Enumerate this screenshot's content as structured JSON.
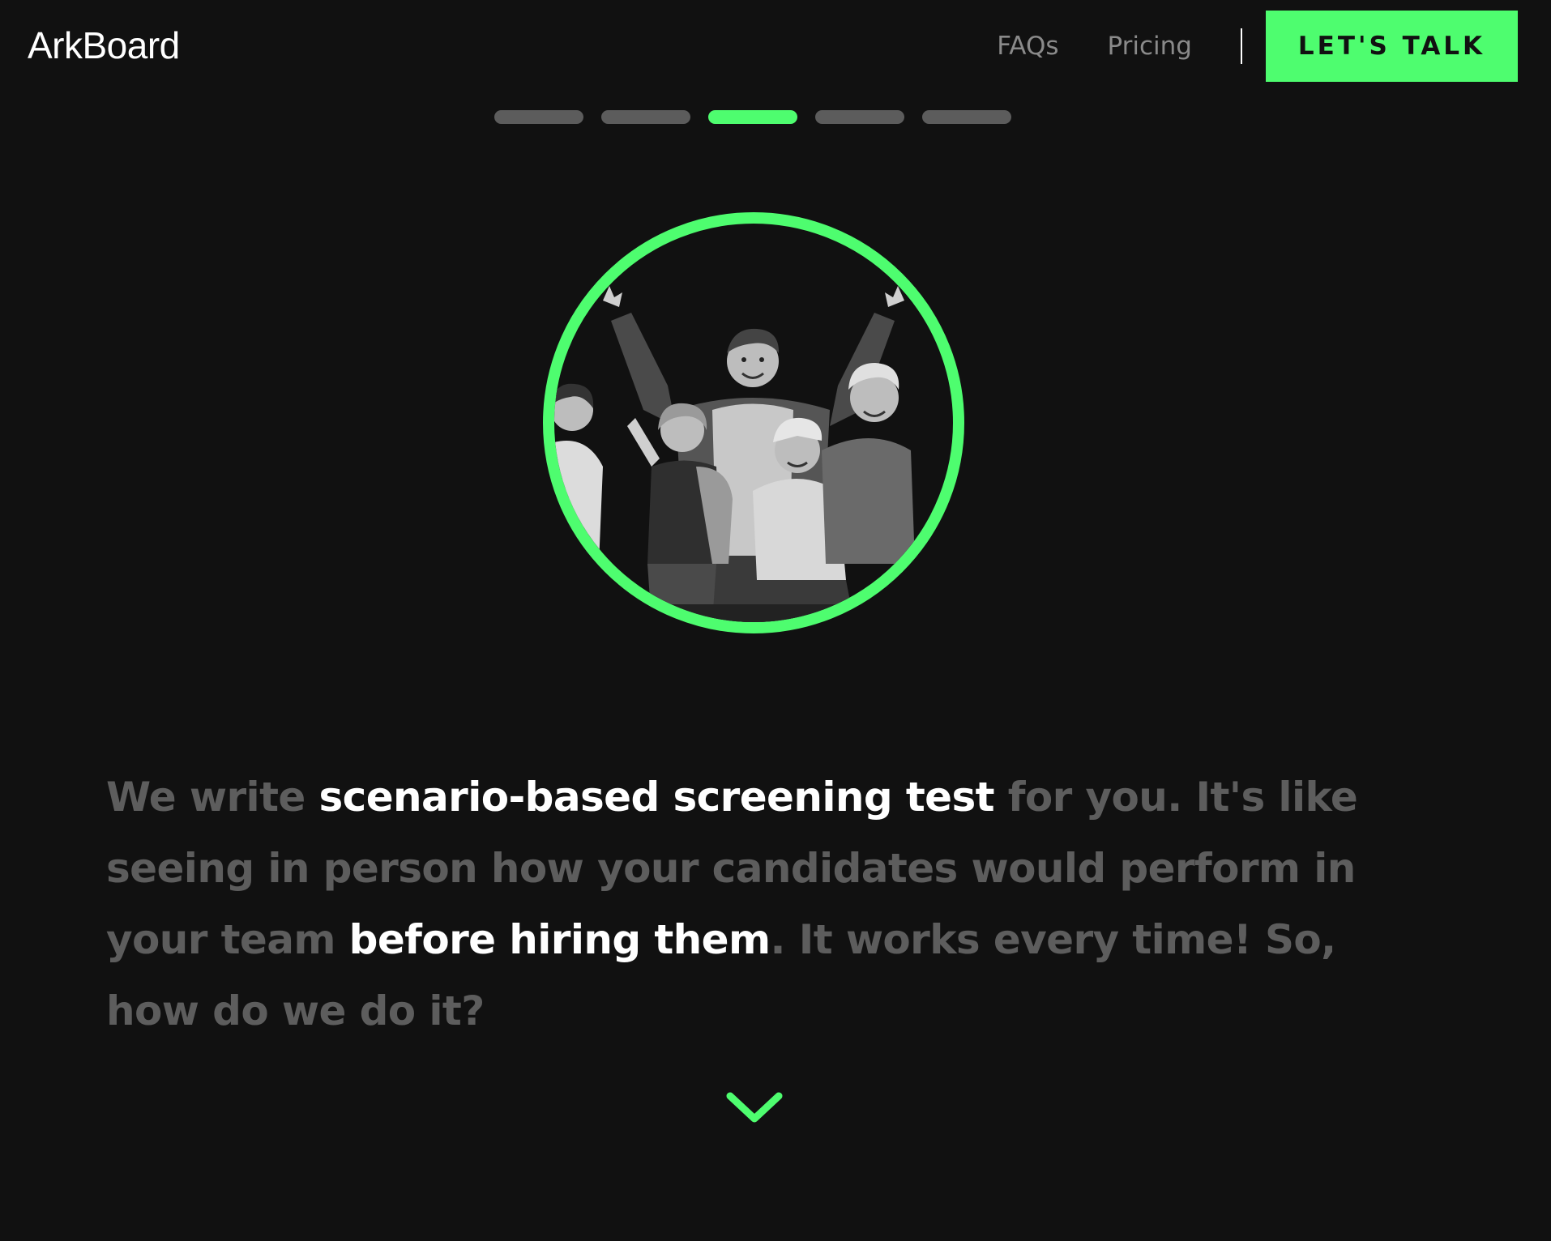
{
  "header": {
    "logo_text": "ArkBoard",
    "nav": [
      {
        "label": "FAQs"
      },
      {
        "label": "Pricing"
      }
    ],
    "cta_label": "LET'S TALK"
  },
  "progress": {
    "segments": 5,
    "active_index": 2
  },
  "illustration": {
    "name": "group-of-people-celebrating"
  },
  "copy": {
    "part1": "We write ",
    "highlight1": "scenario-based screening test",
    "part2": " for you. It's like seeing in person how your candidates would perform in your team ",
    "highlight2": "before hiring them",
    "part3": ". It works every time! So, how do we do it?"
  },
  "colors": {
    "accent": "#4efd6f",
    "background": "#111111",
    "muted_text": "#5d5d5d",
    "highlight_text": "#ffffff"
  },
  "icons": {
    "scroll": "chevron-down-icon"
  }
}
